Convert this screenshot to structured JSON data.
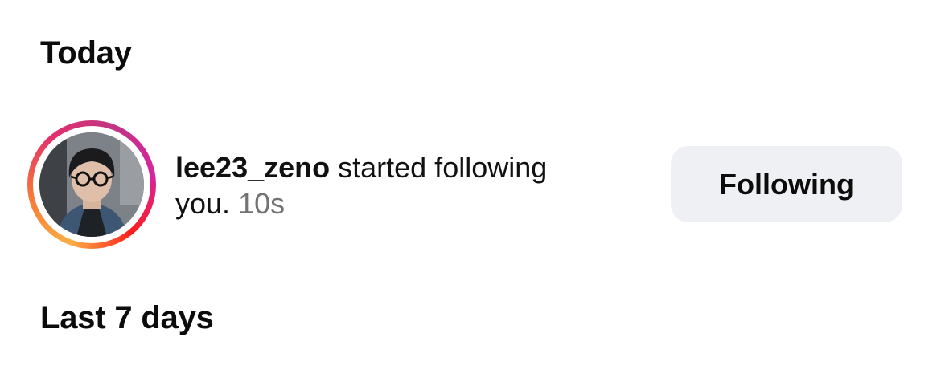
{
  "sections": {
    "today_heading": "Today",
    "last_7_days_heading": "Last 7 days"
  },
  "notification": {
    "username": "lee23_zeno",
    "message_part1": " started following",
    "message_part2": "you.",
    "timestamp": "10s",
    "button_label": "Following",
    "avatar_icon": "user-avatar-photo",
    "story_ring_colors": [
      "#fcaf45",
      "#f77737",
      "#e1306c",
      "#c13584",
      "#d6249f"
    ]
  },
  "colors": {
    "button_background": "#eff0f4",
    "timestamp_text": "#737373",
    "primary_text": "#0c0c0c"
  }
}
